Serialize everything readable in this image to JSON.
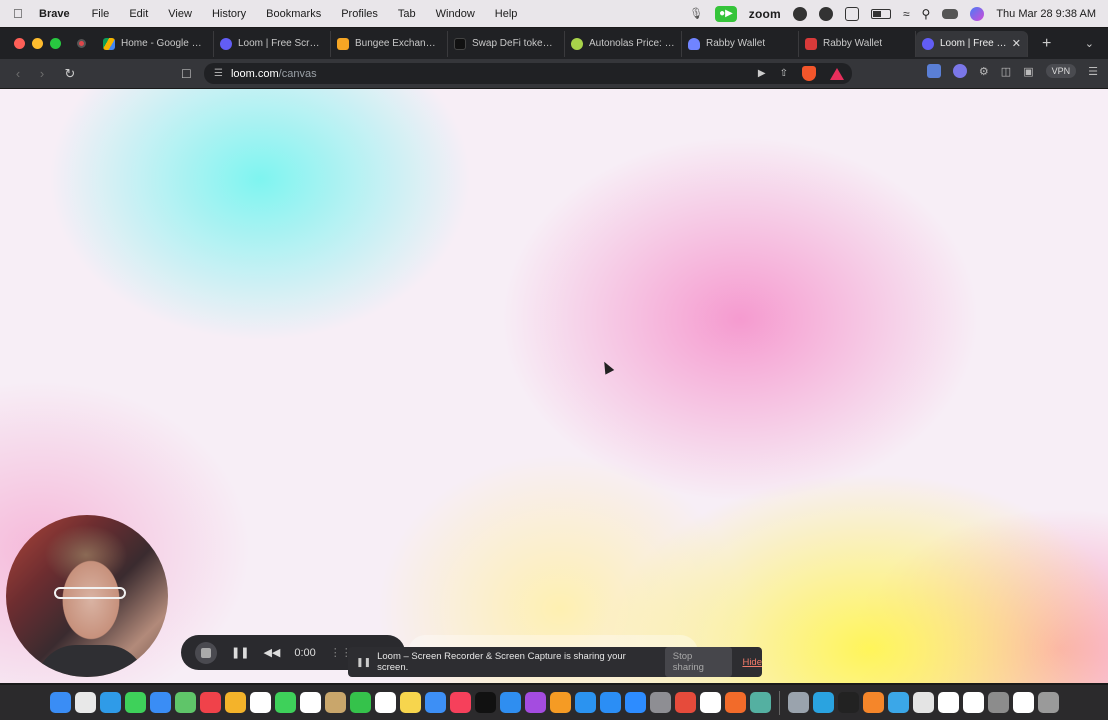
{
  "menubar": {
    "app_name": "Brave",
    "items": [
      "File",
      "Edit",
      "View",
      "History",
      "Bookmarks",
      "Profiles",
      "Tab",
      "Window",
      "Help"
    ],
    "zoom_label": "zoom",
    "clock": "Thu Mar 28  9:38 AM"
  },
  "tabs": [
    {
      "label": "Home - Google Drive",
      "color": "#4285f4"
    },
    {
      "label": "Loom | Free Screen Recorder",
      "color": "#625df5"
    },
    {
      "label": "Bungee Exchange - ",
      "color": "#f5a524"
    },
    {
      "label": "Swap DeFi tokens on",
      "color": "#111111"
    },
    {
      "label": "Autonolas Price: OL",
      "color": "#a8d34a"
    },
    {
      "label": "Rabby Wallet",
      "color": "#7084ff"
    },
    {
      "label": "Rabby Wallet",
      "color": "#d83a3a"
    },
    {
      "label": "Loom | Free Screen",
      "color": "#625df5",
      "active": true
    }
  ],
  "address": {
    "site": "loom.com",
    "path": "/canvas"
  },
  "toolbar": {
    "vpn_label": "VPN"
  },
  "loom": {
    "timer": "0:00"
  },
  "share_notice": {
    "message": "Loom – Screen Recorder & Screen Capture is sharing your screen.",
    "stop_label": "Stop sharing",
    "hide_label": "Hide"
  },
  "dock": {
    "icons": [
      "finder",
      "launchpad",
      "safari",
      "messages",
      "mail",
      "maps",
      "news",
      "photos",
      "reminders",
      "facetime",
      "calendar",
      "contacts",
      "numbers",
      "notion",
      "notes",
      "chrome",
      "music",
      "apple-tv",
      "keynote",
      "podcasts",
      "pages",
      "xcode",
      "app-store",
      "zoom",
      "system-settings",
      "chrome-alt",
      "safari-alt",
      "brave",
      "vpn",
      "utilities",
      "telegram",
      "terminal",
      "metamask",
      "network",
      "preview",
      "documents",
      "files",
      "help",
      "keyboard",
      "trash"
    ],
    "colors": [
      "#3a8df5",
      "#e8e8e8",
      "#2f9be8",
      "#3ed15a",
      "#3a8df5",
      "#5fc569",
      "#f0424a",
      "#f4b32a",
      "#ffffff",
      "#3ed15a",
      "#ffffff",
      "#c9a66b",
      "#35c24b",
      "#ffffff",
      "#f7d54d",
      "#3d8ff5",
      "#f6405b",
      "#111111",
      "#2f8ef0",
      "#a44ce0",
      "#f59b24",
      "#2b93f0",
      "#2b8ef5",
      "#2d8cff",
      "#8e8e93",
      "#e64b3b",
      "#ffffff",
      "#f26b2a",
      "#54b0a1",
      "#9aa3ad",
      "#2aa3e0",
      "#222222",
      "#f5862a",
      "#3ba7e8",
      "#e4e4e4",
      "#ffffff",
      "#ffffff",
      "#8c8c8c",
      "#ffffff",
      "#9a9a9a"
    ]
  }
}
